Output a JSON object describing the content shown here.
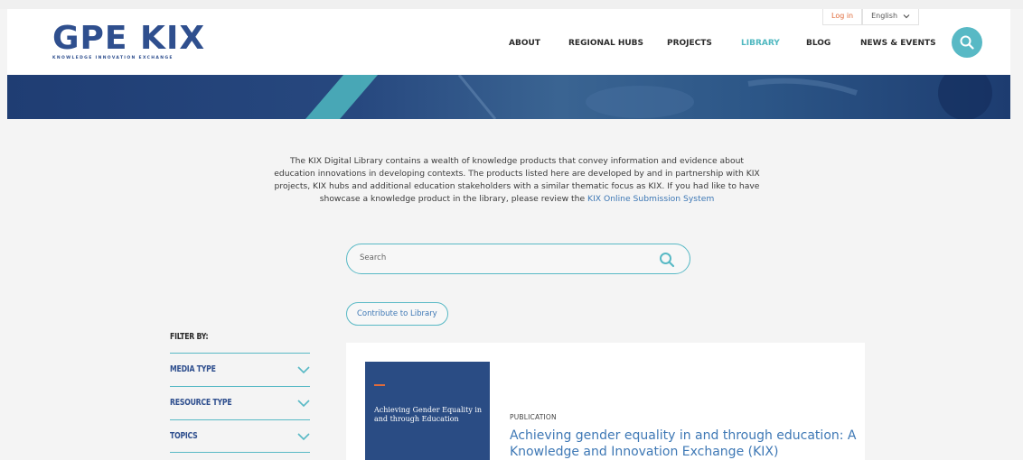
{
  "header": {
    "logo": {
      "main": "GPE KIX",
      "sub": "KNOWLEDGE INNOVATION EXCHANGE"
    },
    "top_links": {
      "login": "Log in",
      "language": "English"
    },
    "nav": [
      {
        "label": "ABOUT"
      },
      {
        "label": "REGIONAL HUBS"
      },
      {
        "label": "PROJECTS"
      },
      {
        "label": "LIBRARY",
        "active": true
      },
      {
        "label": "BLOG"
      },
      {
        "label": "NEWS & EVENTS"
      }
    ],
    "search_icon": "search-icon"
  },
  "intro": {
    "text": "The KIX Digital Library contains a wealth of knowledge products that convey information and evidence about education innovations in developing contexts. The products listed here are developed by and in partnership with KIX projects, KIX hubs and additional education stakeholders with a similar thematic focus as KIX. If you had like to have showcase a knowledge product in the library, please review the ",
    "link": "KIX Online Submission System"
  },
  "search": {
    "placeholder": "Search"
  },
  "contribute_label": "Contribute to Library",
  "filters": {
    "title": "FILTER BY:",
    "items": [
      {
        "label": "MEDIA TYPE"
      },
      {
        "label": "RESOURCE TYPE"
      },
      {
        "label": "TOPICS"
      }
    ]
  },
  "results": [
    {
      "cover_title": "Achieving Gender Equality in and through Education",
      "type": "PUBLICATION",
      "title": "Achieving gender equality in and through education: A Knowledge and Innovation Exchange (KIX)"
    }
  ],
  "colors": {
    "brand": "#2f4f8e",
    "accent": "#58b9c5",
    "link": "#3e78b5",
    "login": "#e06b3b"
  }
}
